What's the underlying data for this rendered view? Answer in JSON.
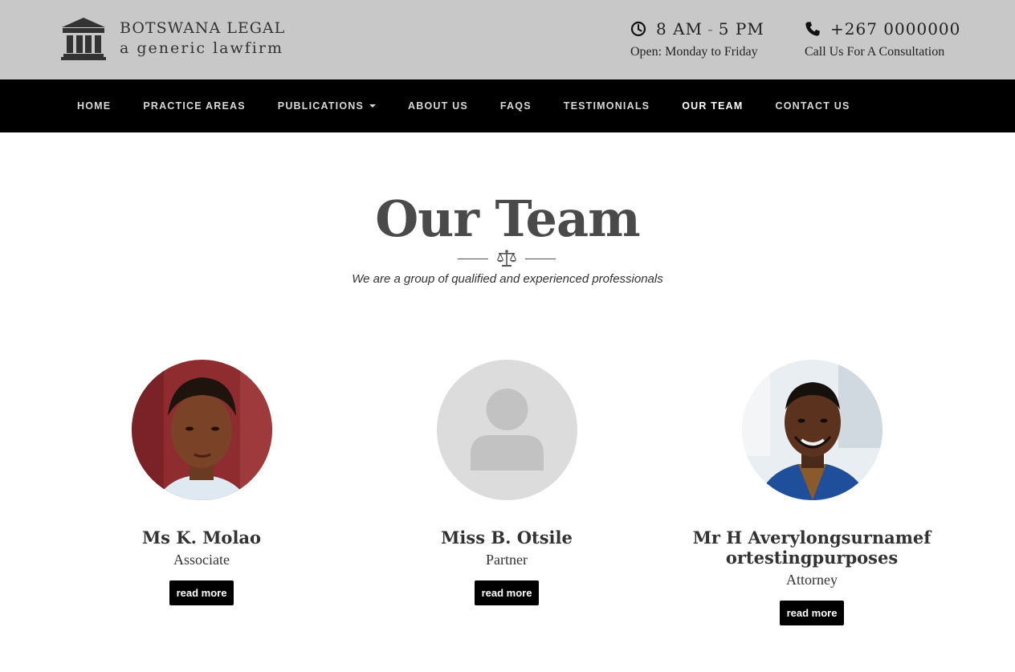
{
  "brand": {
    "name": "BOTSWANA LEGAL",
    "tagline": "a generic lawfirm",
    "logo_icon": "courthouse-icon"
  },
  "hours": {
    "icon": "clock-icon",
    "open_time": "8 AM",
    "separator": "-",
    "close_time": "5 PM",
    "days": "Open: Monday to Friday"
  },
  "phone": {
    "icon": "phone-icon",
    "number": "+267 0000000",
    "caption": "Call Us For A Consultation"
  },
  "nav": {
    "items": [
      {
        "label": "HOME"
      },
      {
        "label": "PRACTICE AREAS"
      },
      {
        "label": "PUBLICATIONS"
      },
      {
        "label": "ABOUT US"
      },
      {
        "label": "FAQS"
      },
      {
        "label": "TESTIMONIALS"
      },
      {
        "label": "OUR TEAM"
      },
      {
        "label": "CONTACT US"
      }
    ],
    "active": "OUR TEAM"
  },
  "section": {
    "title": "Our Team",
    "divider_icon": "scales-icon",
    "subtitle": "We are a group of qualified and experienced professionals"
  },
  "team": [
    {
      "name": "Ms K. Molao",
      "role": "Associate",
      "button": "read more"
    },
    {
      "name": "Miss B. Otsile",
      "role": "Partner",
      "button": "read more"
    },
    {
      "name": "Mr H Averylongsurnamefortestingpurposes",
      "role": "Attorney",
      "button": "read more"
    }
  ],
  "colors": {
    "header_bg": "#c8c8c8",
    "nav_bg": "#000000",
    "button_bg": "#000000",
    "heading_text": "#4a4a4a"
  }
}
